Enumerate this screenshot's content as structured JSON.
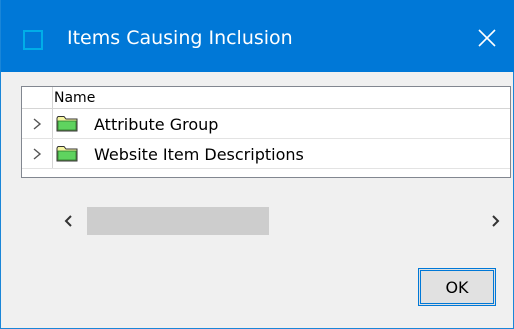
{
  "window": {
    "title": "Items Causing Inclusion",
    "title_icon": "window-app-icon",
    "close_icon": "close-icon",
    "accent_color": "#0078d7"
  },
  "tree": {
    "column_header": "Name",
    "rows": [
      {
        "label": "Attribute Group",
        "icon": "folder-icon",
        "expander": "chevron-right-icon"
      },
      {
        "label": "Website Item Descriptions",
        "icon": "folder-icon",
        "expander": "chevron-right-icon"
      }
    ]
  },
  "buttons": {
    "ok_label": "OK"
  }
}
